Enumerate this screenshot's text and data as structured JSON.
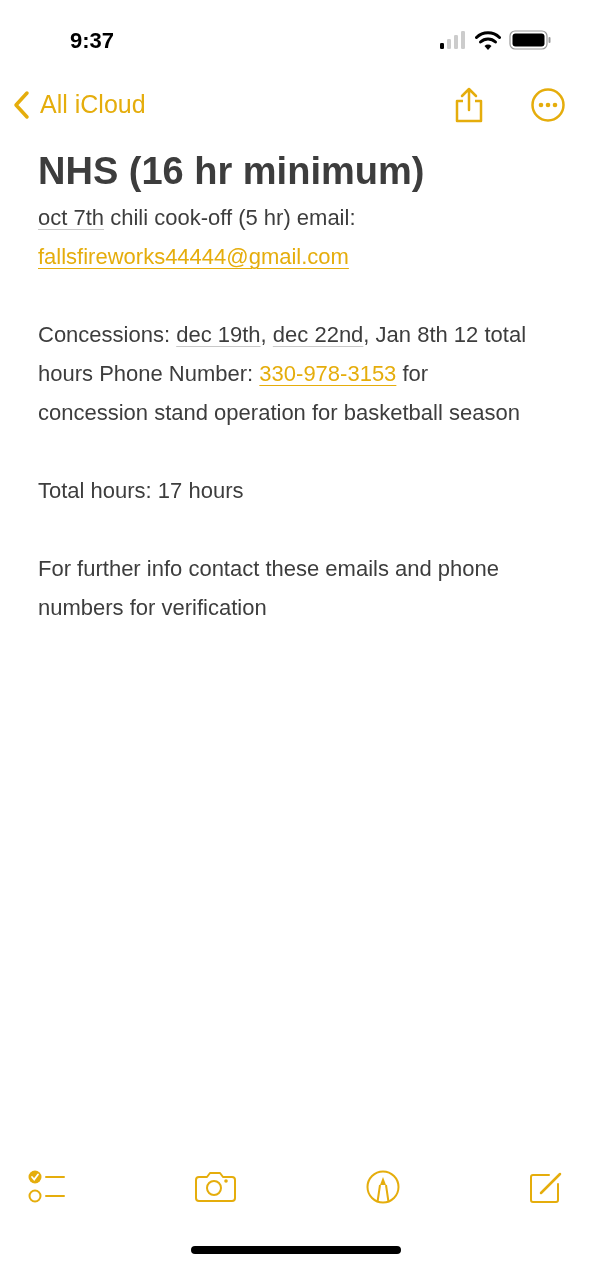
{
  "status_bar": {
    "time": "9:37"
  },
  "nav": {
    "back_label": "All iCloud"
  },
  "note": {
    "title": "NHS (16 hr minimum)",
    "paragraphs": [
      [
        {
          "kind": "date",
          "text": "oct 7th"
        },
        {
          "kind": "text",
          "text": " chili cook-off (5 hr) email: "
        },
        {
          "kind": "link",
          "text": "fallsfireworks44444@gmail.com"
        }
      ],
      [
        {
          "kind": "text",
          "text": "Concessions: "
        },
        {
          "kind": "date",
          "text": "dec 19th"
        },
        {
          "kind": "text",
          "text": ", "
        },
        {
          "kind": "date",
          "text": "dec 22nd"
        },
        {
          "kind": "text",
          "text": ", Jan 8th 12 total hours Phone Number: "
        },
        {
          "kind": "link",
          "text": "330-978-3153"
        },
        {
          "kind": "text",
          "text": " for concession stand operation for basketball season"
        }
      ],
      [
        {
          "kind": "text",
          "text": "Total hours: 17 hours"
        }
      ],
      [
        {
          "kind": "text",
          "text": "For further info contact these emails and phone numbers for verification"
        }
      ]
    ]
  }
}
